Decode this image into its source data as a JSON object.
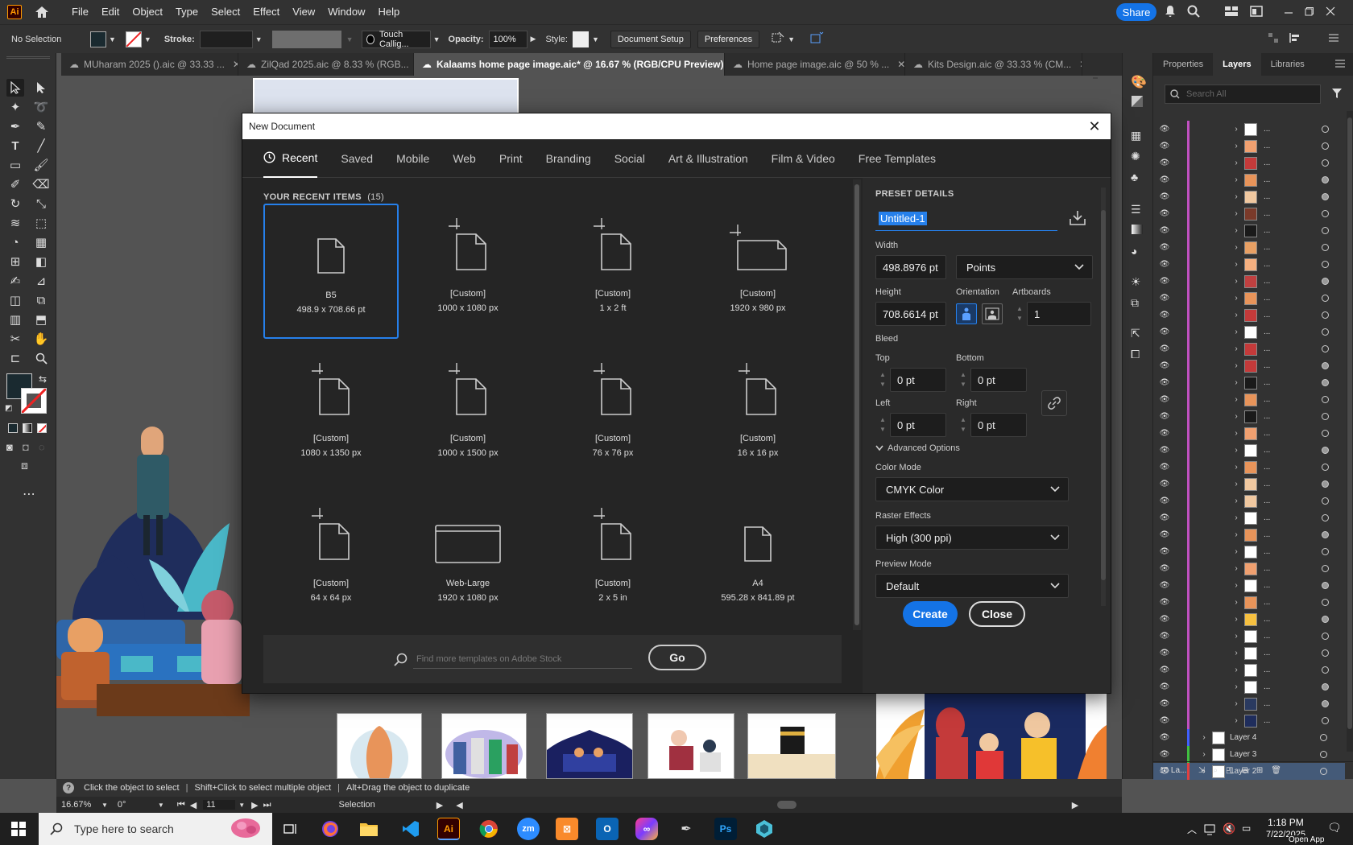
{
  "app": {
    "logo": "Ai"
  },
  "menu": [
    "File",
    "Edit",
    "Object",
    "Type",
    "Select",
    "Effect",
    "View",
    "Window",
    "Help"
  ],
  "share_label": "Share",
  "control": {
    "selection": "No Selection",
    "stroke_label": "Stroke:",
    "brush": "Touch Callig...",
    "opacity_label": "Opacity:",
    "opacity_value": "100%",
    "style_label": "Style:",
    "doc_setup": "Document Setup",
    "preferences": "Preferences"
  },
  "tabs": [
    {
      "label": "MUharam 2025 ().aic @ 33.33 ...",
      "active": false
    },
    {
      "label": "ZilQad 2025.aic @ 8.33 % (RGB...",
      "active": false
    },
    {
      "label": "Kalaams home page image.aic* @ 16.67 % (RGB/CPU Preview)",
      "active": true
    },
    {
      "label": "Home page image.aic @ 50 % ...",
      "active": false
    },
    {
      "label": "Kits Design.aic @ 33.33 % (CM...",
      "active": false
    }
  ],
  "panel": {
    "tabs": [
      "Properties",
      "Layers",
      "Libraries"
    ],
    "active_tab": "Layers",
    "search_placeholder": "Search All",
    "sublayer_label": "...",
    "layers": [
      "Layer 4",
      "Layer 3",
      "Layer 2"
    ],
    "footer_count": "10 La..."
  },
  "dialog": {
    "title": "New Document",
    "categories": [
      "Recent",
      "Saved",
      "Mobile",
      "Web",
      "Print",
      "Branding",
      "Social",
      "Art & Illustration",
      "Film & Video",
      "Free Templates"
    ],
    "active_category": "Recent",
    "recent_heading": "YOUR RECENT ITEMS",
    "recent_count": "(15)",
    "items": [
      {
        "name": "B5",
        "size": "498.9 x 708.66 pt",
        "icon": "page-icon"
      },
      {
        "name": "[Custom]",
        "size": "1000 x 1080 px",
        "icon": "custom-page-icon"
      },
      {
        "name": "[Custom]",
        "size": "1 x 2 ft",
        "icon": "custom-page-icon"
      },
      {
        "name": "[Custom]",
        "size": "1920 x 980 px",
        "icon": "custom-landscape-icon"
      },
      {
        "name": "[Custom]",
        "size": "1080 x 1350 px",
        "icon": "custom-page-icon"
      },
      {
        "name": "[Custom]",
        "size": "1000 x 1500 px",
        "icon": "custom-page-icon"
      },
      {
        "name": "[Custom]",
        "size": "76 x 76 px",
        "icon": "custom-page-icon"
      },
      {
        "name": "[Custom]",
        "size": "16 x 16 px",
        "icon": "custom-page-icon"
      },
      {
        "name": "[Custom]",
        "size": "64 x 64 px",
        "icon": "custom-page-icon"
      },
      {
        "name": "Web-Large",
        "size": "1920 x 1080 px",
        "icon": "browser-window-icon"
      },
      {
        "name": "[Custom]",
        "size": "2 x 5 in",
        "icon": "custom-page-icon"
      },
      {
        "name": "A4",
        "size": "595.28 x 841.89 pt",
        "icon": "page-icon"
      }
    ],
    "template_search_placeholder": "Find more templates on Adobe Stock",
    "go_label": "Go",
    "preset": {
      "heading": "PRESET DETAILS",
      "name": "Untitled-1",
      "width_label": "Width",
      "width": "498.8976 pt",
      "units": "Points",
      "height_label": "Height",
      "height": "708.6614 pt",
      "orientation_label": "Orientation",
      "artboards_label": "Artboards",
      "artboards": "1",
      "bleed_label": "Bleed",
      "top_label": "Top",
      "top": "0 pt",
      "bottom_label": "Bottom",
      "bottom": "0 pt",
      "left_label": "Left",
      "left": "0 pt",
      "right_label": "Right",
      "right": "0 pt",
      "advanced_label": "Advanced Options",
      "color_mode_label": "Color Mode",
      "color_mode": "CMYK Color",
      "raster_label": "Raster Effects",
      "raster": "High (300 ppi)",
      "preview_label": "Preview Mode",
      "preview": "Default"
    },
    "create_label": "Create",
    "close_label": "Close"
  },
  "hint": {
    "text1": "Click the object to select",
    "text2": "Shift+Click to select multiple object",
    "text3": "Alt+Drag the object to duplicate"
  },
  "status": {
    "zoom": "16.67%",
    "rotation": "0°",
    "artboard": "11",
    "tool": "Selection"
  },
  "taskbar": {
    "search_placeholder": "Type here to search",
    "time": "1:18 PM",
    "date": "7/22/2025",
    "open_app": "Open App"
  },
  "colors": {
    "accent": "#1473e6",
    "selection": "#2680eb",
    "layer_purple": "#c050c0",
    "layer_green": "#40c040",
    "layer_blue": "#4060ff"
  }
}
